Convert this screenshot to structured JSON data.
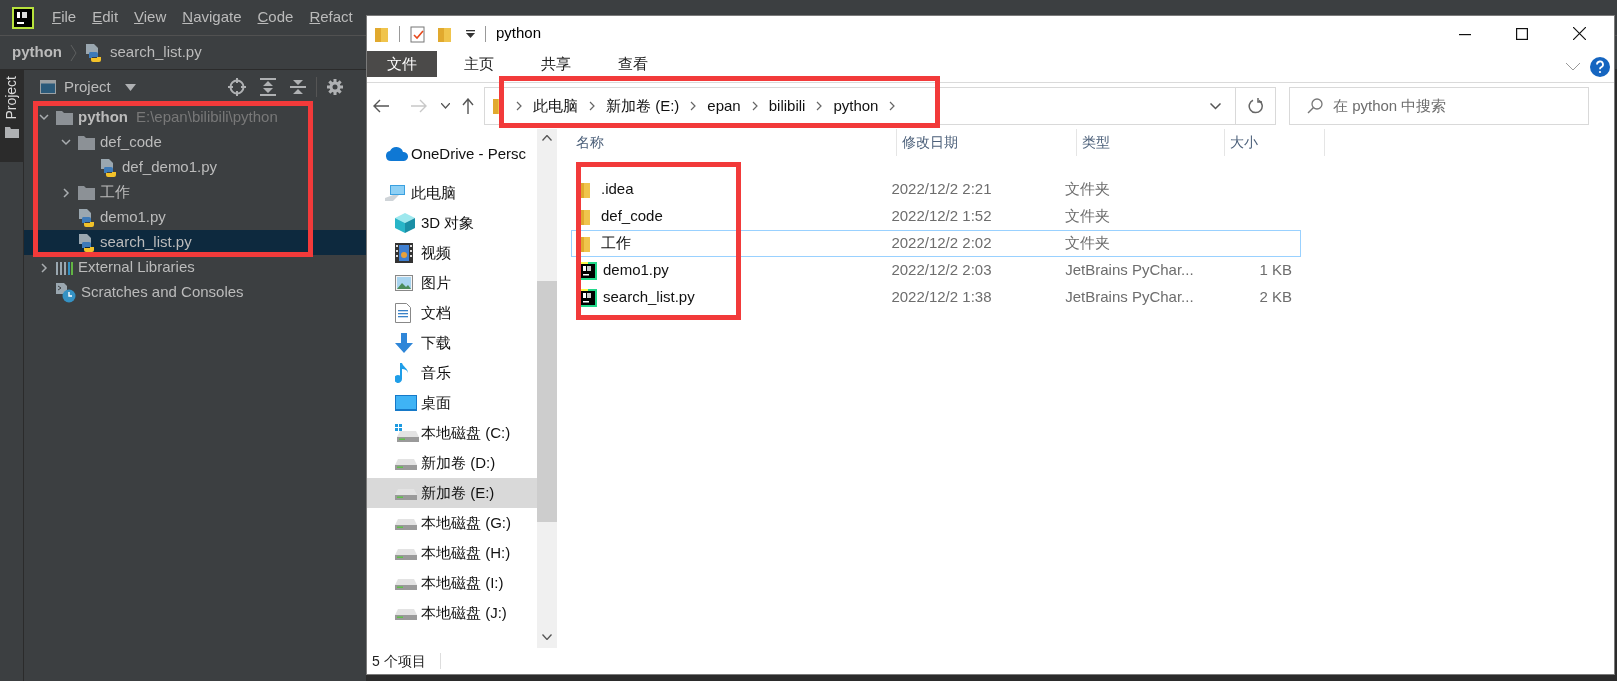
{
  "ide": {
    "menu": [
      "File",
      "Edit",
      "View",
      "Navigate",
      "Code",
      "Refact"
    ],
    "breadcrumb": [
      "python",
      "search_list.py"
    ],
    "side_tab": "Project",
    "panel_title": "Project",
    "tree": [
      {
        "label": "python",
        "path": "E:\\epan\\bilibili\\python",
        "kind": "folder",
        "expanded": true,
        "selected": false,
        "children": [
          {
            "label": "def_code",
            "kind": "folder",
            "expanded": true,
            "selected": false,
            "children": [
              {
                "label": "def_demo1.py",
                "kind": "python",
                "selected": false
              }
            ]
          },
          {
            "label": "工作",
            "kind": "folder",
            "expanded": false,
            "selected": false
          },
          {
            "label": "demo1.py",
            "kind": "python",
            "selected": false
          },
          {
            "label": "search_list.py",
            "kind": "python",
            "selected": true
          }
        ]
      },
      {
        "label": "External Libraries",
        "kind": "libraries",
        "expanded": false,
        "selected": false
      },
      {
        "label": "Scratches and Consoles",
        "kind": "scratches",
        "selected": false
      }
    ]
  },
  "explorer": {
    "title": "python",
    "ribbon_tabs": [
      {
        "label": "文件",
        "selected": true
      },
      {
        "label": "主页",
        "selected": false
      },
      {
        "label": "共享",
        "selected": false
      },
      {
        "label": "查看",
        "selected": false
      }
    ],
    "address": [
      "此电脑",
      "新加卷 (E:)",
      "epan",
      "bilibili",
      "python"
    ],
    "search_placeholder": "在 python 中搜索",
    "nav": [
      {
        "label": "OneDrive - Persc",
        "kind": "onedrive",
        "selected": false
      },
      {
        "label": "此电脑",
        "kind": "pc",
        "selected": false
      },
      {
        "label": "3D 对象",
        "kind": "objects3d",
        "selected": false
      },
      {
        "label": "视频",
        "kind": "video",
        "selected": false
      },
      {
        "label": "图片",
        "kind": "pictures",
        "selected": false
      },
      {
        "label": "文档",
        "kind": "documents",
        "selected": false
      },
      {
        "label": "下载",
        "kind": "downloads",
        "selected": false
      },
      {
        "label": "音乐",
        "kind": "music",
        "selected": false
      },
      {
        "label": "桌面",
        "kind": "desktop",
        "selected": false
      },
      {
        "label": "本地磁盘 (C:)",
        "kind": "system_drive",
        "selected": false
      },
      {
        "label": "新加卷 (D:)",
        "kind": "drive",
        "selected": false
      },
      {
        "label": "新加卷 (E:)",
        "kind": "drive",
        "selected": true
      },
      {
        "label": "本地磁盘 (G:)",
        "kind": "drive",
        "selected": false
      },
      {
        "label": "本地磁盘 (H:)",
        "kind": "drive",
        "selected": false
      },
      {
        "label": "本地磁盘 (I:)",
        "kind": "drive",
        "selected": false
      },
      {
        "label": "本地磁盘 (J:)",
        "kind": "drive",
        "selected": false
      }
    ],
    "columns": [
      "名称",
      "修改日期",
      "类型",
      "大小"
    ],
    "rows": [
      {
        "name": ".idea",
        "kind": "folder",
        "date": "2022/12/2 2:21",
        "type": "文件夹",
        "selected": false
      },
      {
        "name": "def_code",
        "kind": "folder",
        "date": "2022/12/2 1:52",
        "type": "文件夹",
        "selected": false
      },
      {
        "name": "工作",
        "kind": "folder",
        "date": "2022/12/2 2:02",
        "type": "文件夹",
        "selected": true
      },
      {
        "name": "demo1.py",
        "kind": "pycharm",
        "date": "2022/12/2 2:03",
        "type": "JetBrains PyChar...",
        "size": "1 KB",
        "selected": false
      },
      {
        "name": "search_list.py",
        "kind": "pycharm",
        "date": "2022/12/2 1:38",
        "type": "JetBrains PyChar...",
        "size": "2 KB",
        "selected": false
      }
    ],
    "status": "5 个项目"
  }
}
